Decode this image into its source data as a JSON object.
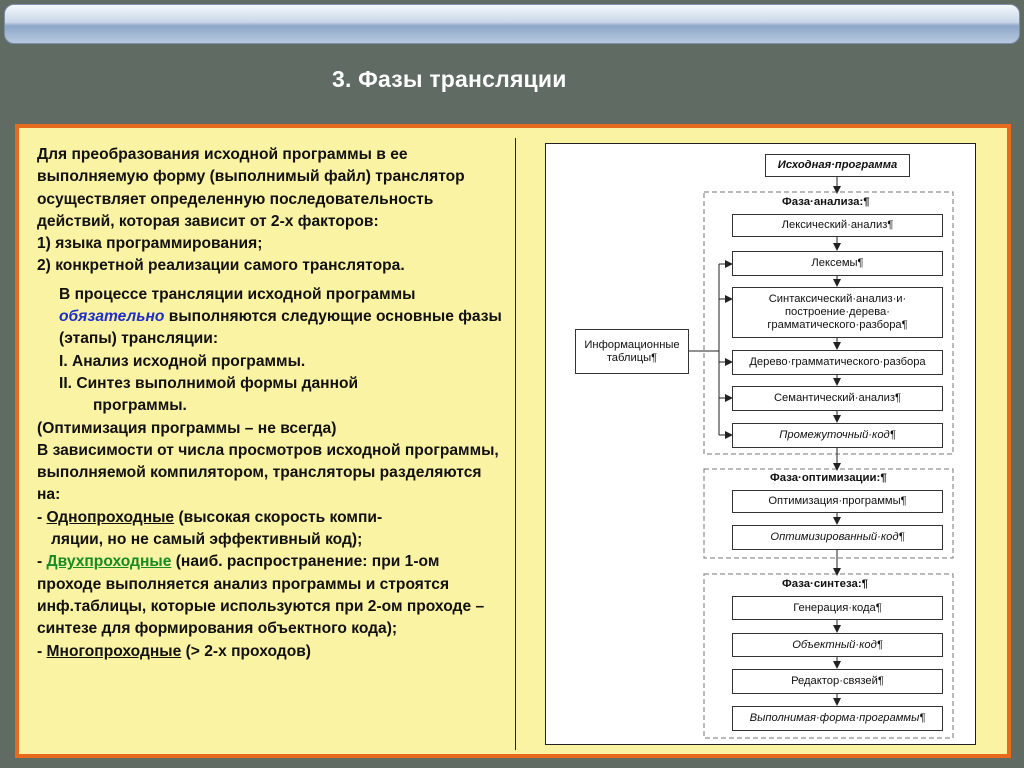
{
  "slide": {
    "title": "3. Фазы трансляции"
  },
  "text": {
    "intro_1": "Для преобразования исходной программы в ее выполняемую форму (выполнимый файл) транслятор осуществляет определенную последовательность действий, которая зависит от 2-х факторов:",
    "factor_1": "1) языка программирования;",
    "factor_2": "2) конкретной реализации самого транслятора.",
    "para2_a": "В процессе трансляции исходной программы ",
    "para2_em": "обязательно",
    "para2_b": " выполняются следующие основные фазы (этапы) трансляции:",
    "phase_1": "I.  Анализ исходной программы.",
    "phase_2a": "II. Синтез выполнимой формы данной",
    "phase_2b": "программы.",
    "optim_note": "(Оптимизация программы – не всегда)",
    "passes_intro": "В зависимости от числа просмотров исходной программы, выполняемой компилятором, трансляторы разделяются на:",
    "one_pass_dash": "- ",
    "one_pass_term": "Однопроходные",
    "one_pass_desc": " (высокая скорость компи-",
    "one_pass_desc2": "ляции, но не самый эффективный код);",
    "two_pass_dash": "- ",
    "two_pass_term": "Двухпроходные",
    "two_pass_desc": " (наиб. распространение: при 1-ом проходе выполняется анализ программы и строятся инф.таблицы, которые используются при 2-ом проходе – синтезе для формирования объектного кода);",
    "multi_pass_dash": "- ",
    "multi_pass_term": "Многопроходные",
    "multi_pass_desc": " (> 2-х проходов)"
  },
  "diagram": {
    "source": "Исходная·программа",
    "info_tables": "Информационные таблицы¶",
    "analysis_phase": "Фаза·анализа:¶",
    "lexical": "Лексический·анализ¶",
    "lexemes": "Лексемы¶",
    "syntax": "Синтаксический·анализ·и· построение·дерева· грамматического·разбора¶",
    "parse_tree": "Дерево·грамматического·разбора",
    "semantic": "Семантический·анализ¶",
    "intermediate": "Промежуточный·код¶",
    "optim_phase": "Фаза·оптимизации:¶",
    "optimization": "Оптимизация·программы¶",
    "optimized_code": "Оптимизированный·код¶",
    "synth_phase": "Фаза·синтеза:¶",
    "codegen": "Генерация·кода¶",
    "object_code": "Объектный·код¶",
    "linker": "Редактор·связей¶",
    "executable": "Выполнимая·форма·программы¶"
  },
  "colors": {
    "background": "#5f6b63",
    "content_bg": "#fbf3a4",
    "content_border": "#e86a1d",
    "emphasis_blue": "#1c2fc9",
    "term_green": "#168a23"
  }
}
